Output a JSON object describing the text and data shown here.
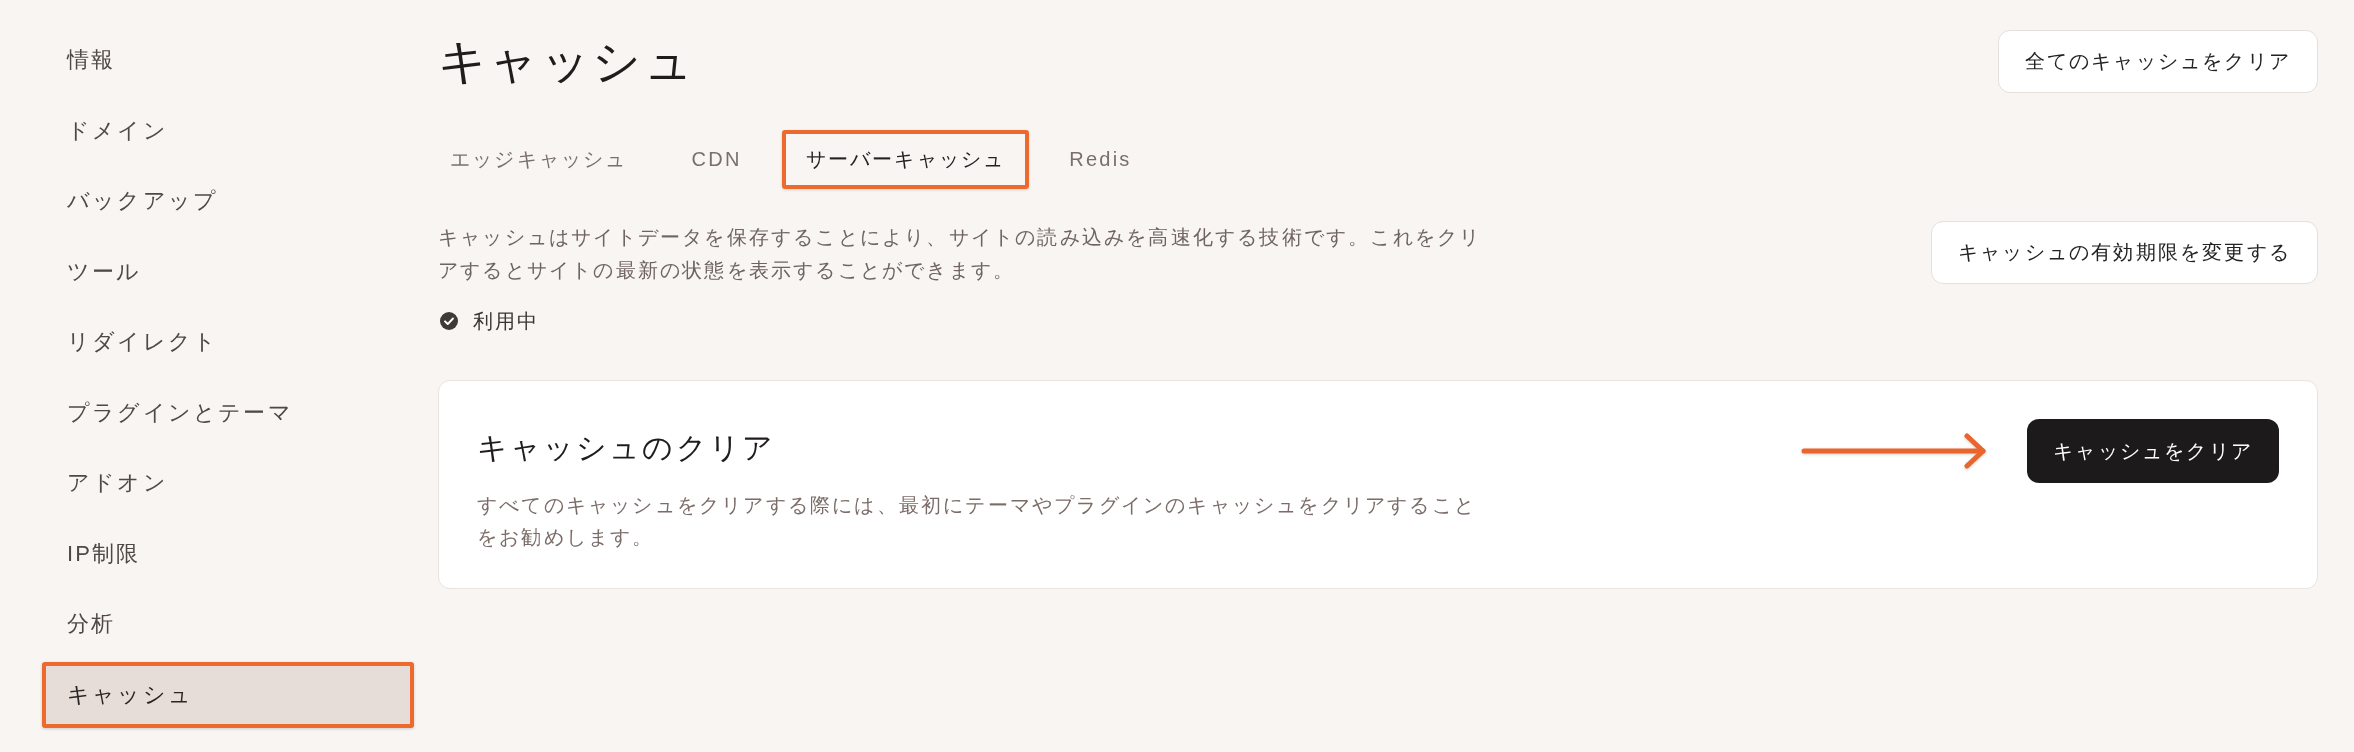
{
  "sidebar": {
    "items": [
      {
        "label": "情報",
        "selected": false,
        "highlighted": false
      },
      {
        "label": "ドメイン",
        "selected": false,
        "highlighted": false
      },
      {
        "label": "バックアップ",
        "selected": false,
        "highlighted": false
      },
      {
        "label": "ツール",
        "selected": false,
        "highlighted": false
      },
      {
        "label": "リダイレクト",
        "selected": false,
        "highlighted": false
      },
      {
        "label": "プラグインとテーマ",
        "selected": false,
        "highlighted": false
      },
      {
        "label": "アドオン",
        "selected": false,
        "highlighted": false
      },
      {
        "label": "IP制限",
        "selected": false,
        "highlighted": false
      },
      {
        "label": "分析",
        "selected": false,
        "highlighted": false
      },
      {
        "label": "キャッシュ",
        "selected": true,
        "highlighted": true
      }
    ]
  },
  "header": {
    "title": "キャッシュ",
    "clear_all_button": "全てのキャッシュをクリア"
  },
  "tabs": [
    {
      "label": "エッジキャッシュ",
      "selected": false,
      "highlighted": false
    },
    {
      "label": "CDN",
      "selected": false,
      "highlighted": false
    },
    {
      "label": "サーバーキャッシュ",
      "selected": true,
      "highlighted": true
    },
    {
      "label": "Redis",
      "selected": false,
      "highlighted": false
    }
  ],
  "description": "キャッシュはサイトデータを保存することにより、サイトの読み込みを高速化する技術です。これをクリアするとサイトの最新の状態を表示することができます。",
  "change_expiry_button": "キャッシュの有効期限を変更する",
  "status": {
    "label": "利用中",
    "enabled": true
  },
  "clear_card": {
    "title": "キャッシュのクリア",
    "description": "すべてのキャッシュをクリアする際には、最初にテーマやプラグインのキャッシュをクリアすることをお勧めします。",
    "button": {
      "label": "キャッシュをクリア",
      "highlighted": true
    }
  }
}
